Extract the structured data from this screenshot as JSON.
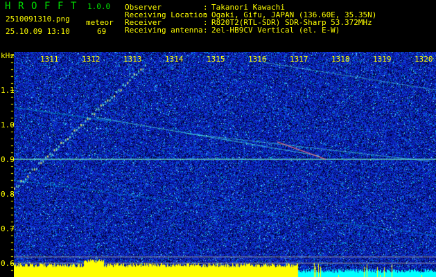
{
  "app": {
    "name_letters": [
      "H",
      "R",
      "O",
      "F",
      "F",
      "T"
    ],
    "version": "1.0.0"
  },
  "file": {
    "name": "2510091310.png",
    "datetime": "25.10.09 13:10"
  },
  "meteor": {
    "label": "meteor",
    "count": "69"
  },
  "info": [
    {
      "label": "Observer",
      "value": "Takanori Kawachi"
    },
    {
      "label": "Receiving Location",
      "value": "Ogaki, Gifu, JAPAN (136.60E, 35.35N)"
    },
    {
      "label": "Receiver",
      "value": "R820T2(RTL-SDR) SDR-Sharp 53.372MHz"
    },
    {
      "label": "Receiving antenna",
      "value": "2el-HB9CV Vertical (el. E-W)"
    }
  ],
  "spectrogram": {
    "y_unit": "kHz",
    "y_ticks": [
      "1.1",
      "1.0",
      "0.9",
      "0.8",
      "0.7",
      "0.6"
    ],
    "x_ticks": [
      "1311",
      "1312",
      "1313",
      "1314",
      "1315",
      "1316",
      "1317",
      "1318",
      "1319",
      "1320"
    ],
    "colors": {
      "background": "#000000",
      "noise": "#0a1ec8",
      "signal": "#00ffff",
      "text": "#ffff00",
      "logo": "#00e000",
      "meter_low": "#ffff00",
      "meter_high": "#00ffff"
    }
  }
}
